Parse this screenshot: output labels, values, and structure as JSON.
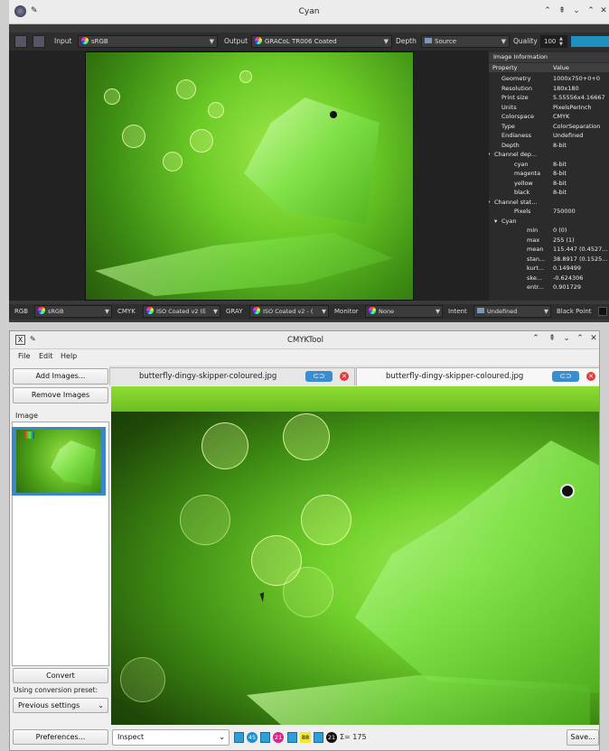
{
  "top_window": {
    "title": "Cyan",
    "toolbar": {
      "input_label": "Input",
      "input_value": "sRGB",
      "output_label": "Output",
      "output_value": "GRACoL TR006 Coated",
      "depth_label": "Depth",
      "depth_value": "Source",
      "quality_label": "Quality",
      "quality_value": "100"
    },
    "info_panel": {
      "title": "Image Information",
      "col_property": "Property",
      "col_value": "Value",
      "rows": [
        {
          "k": "Geometry",
          "v": "1000x750+0+0"
        },
        {
          "k": "Resolution",
          "v": "180x180"
        },
        {
          "k": "Print size",
          "v": "5.55556x4.16667"
        },
        {
          "k": "Units",
          "v": "PixelsPerInch"
        },
        {
          "k": "Colorspace",
          "v": "CMYK"
        },
        {
          "k": "Type",
          "v": "ColorSeparation"
        },
        {
          "k": "Endianess",
          "v": "Undefined"
        },
        {
          "k": "Depth",
          "v": "8-bit"
        },
        {
          "k": "Channel dep...",
          "v": ""
        },
        {
          "k": "cyan",
          "v": "8-bit"
        },
        {
          "k": "magenta",
          "v": "8-bit"
        },
        {
          "k": "yellow",
          "v": "8-bit"
        },
        {
          "k": "black",
          "v": "8-bit"
        },
        {
          "k": "Channel stat...",
          "v": ""
        },
        {
          "k": "Pixels",
          "v": "750000"
        },
        {
          "k": "Cyan",
          "v": ""
        },
        {
          "k": "min",
          "v": "0 (0)"
        },
        {
          "k": "max",
          "v": "255 (1)"
        },
        {
          "k": "mean",
          "v": "115.447 (0.4527..."
        },
        {
          "k": "stan...",
          "v": "38.8917 (0.1525..."
        },
        {
          "k": "kurt...",
          "v": "0.149499"
        },
        {
          "k": "ske...",
          "v": "-0.624306"
        },
        {
          "k": "entr...",
          "v": "0.901729"
        }
      ]
    },
    "status": {
      "rgb_label": "RGB",
      "rgb_value": "sRGB",
      "cmyk_label": "CMYK",
      "cmyk_value": "ISO Coated v2 (E",
      "gray_label": "GRAY",
      "gray_value": "ISO Coated v2 - (",
      "monitor_label": "Monitor",
      "monitor_value": "None",
      "intent_label": "Intent",
      "intent_value": "Undefined",
      "black_point_label": "Black Point"
    }
  },
  "bottom_window": {
    "title": "CMYKTool",
    "menu": [
      "File",
      "Edit",
      "Help"
    ],
    "add_images": "Add Images...",
    "remove_images": "Remove Images",
    "image_header": "Image",
    "convert": "Convert",
    "preset_label": "Using conversion preset:",
    "preset_value": "Previous settings",
    "preferences": "Preferences...",
    "tabs": [
      "butterfly-dingy-skipper-coloured.jpg",
      "butterfly-dingy-skipper-coloured.jpg"
    ],
    "status": {
      "mode_value": "Inspect",
      "chip_c": "45",
      "chip_m": "21",
      "chip_y": "88",
      "chip_k": "21",
      "sum": "Σ= 175",
      "save": "Save..."
    }
  }
}
